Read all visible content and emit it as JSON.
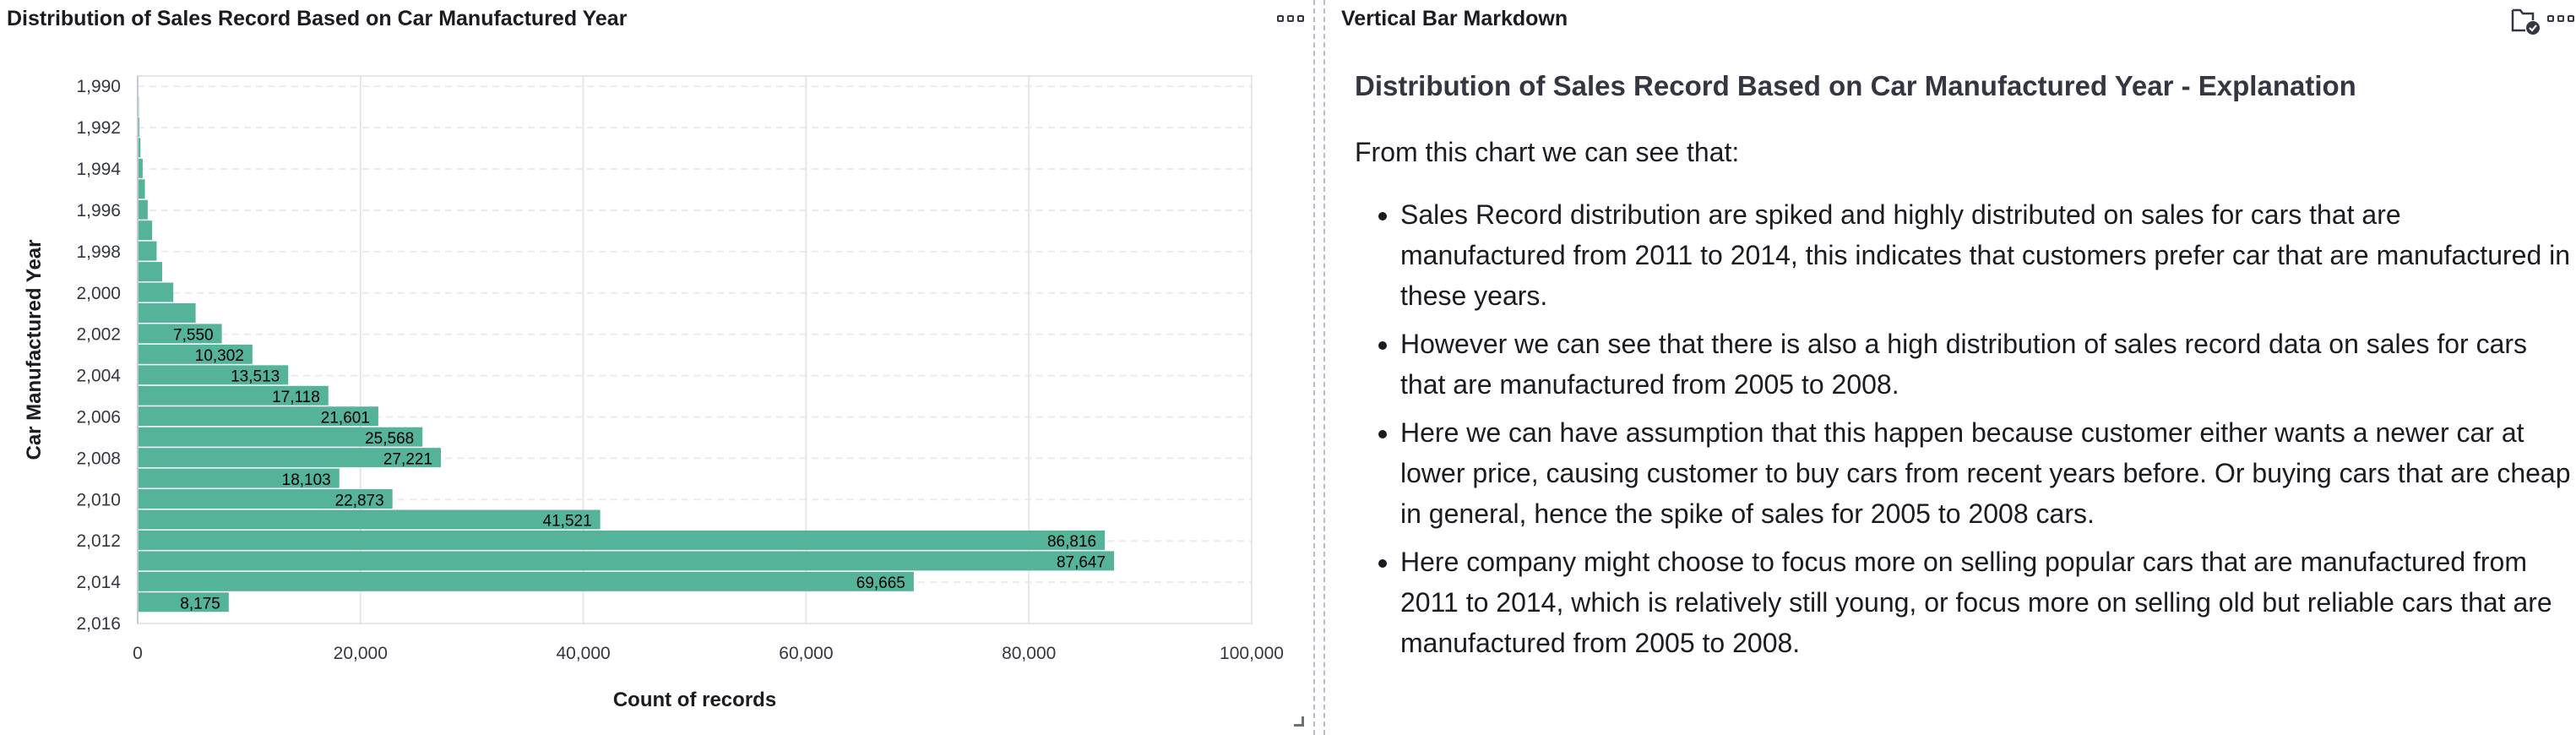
{
  "left_panel": {
    "title": "Distribution of Sales Record Based on Car Manufactured Year"
  },
  "right_panel": {
    "title": "Vertical Bar Markdown",
    "heading": "Distribution of Sales Record Based on Car Manufactured Year - Explanation",
    "intro": "From this chart we can see that:",
    "bullets": [
      "Sales Record distribution are spiked and highly distributed on sales for cars that are manufactured from 2011 to 2014, this indicates that customers prefer car that are manufactured in these years.",
      "However we can see that there is also a high distribution of sales record data on sales for cars that are manufactured from 2005 to 2008.",
      "Here we can have assumption that this happen because customer either wants a newer car at lower price, causing customer to buy cars from recent years before. Or buying cars that are cheap in general, hence the spike of sales for 2005 to 2008 cars.",
      "Here company might choose to focus more on selling popular cars that are manufactured from 2011 to 2014, which is relatively still young, or focus more on selling old but reliable cars that are manufactured from 2005 to 2008."
    ]
  },
  "colors": {
    "bar": "#54b399",
    "text": "#1a1c21",
    "grid": "#e3e6eb"
  },
  "icons": {
    "left_menu": "panel-options-icon",
    "right_menu": "panel-options-icon",
    "right_file": "folder-check-icon"
  },
  "chart_data": {
    "type": "bar",
    "orientation": "horizontal",
    "title": "Distribution of Sales Record Based on Car Manufactured Year",
    "xlabel": "Count of records",
    "ylabel": "Car Manufactured Year",
    "xlim": [
      0,
      100000
    ],
    "ylim": [
      1990,
      2016
    ],
    "x_ticks": [
      "0",
      "20,000",
      "40,000",
      "60,000",
      "80,000",
      "100,000"
    ],
    "y_ticks": [
      "1,990",
      "1,992",
      "1,994",
      "1,996",
      "1,998",
      "2,000",
      "2,002",
      "2,004",
      "2,006",
      "2,008",
      "2,010",
      "2,012",
      "2,014",
      "2,016"
    ],
    "grid": true,
    "bars": [
      {
        "year": 1990,
        "value": 50,
        "label": ""
      },
      {
        "year": 1991,
        "value": 100,
        "label": ""
      },
      {
        "year": 1992,
        "value": 150,
        "label": ""
      },
      {
        "year": 1993,
        "value": 250,
        "label": ""
      },
      {
        "year": 1994,
        "value": 450,
        "label": ""
      },
      {
        "year": 1995,
        "value": 650,
        "label": ""
      },
      {
        "year": 1996,
        "value": 900,
        "label": ""
      },
      {
        "year": 1997,
        "value": 1300,
        "label": ""
      },
      {
        "year": 1998,
        "value": 1700,
        "label": ""
      },
      {
        "year": 1999,
        "value": 2200,
        "label": ""
      },
      {
        "year": 2000,
        "value": 3200,
        "label": ""
      },
      {
        "year": 2001,
        "value": 5200,
        "label": ""
      },
      {
        "year": 2002,
        "value": 7550,
        "label": "7,550"
      },
      {
        "year": 2003,
        "value": 10302,
        "label": "10,302"
      },
      {
        "year": 2004,
        "value": 13513,
        "label": "13,513"
      },
      {
        "year": 2005,
        "value": 17118,
        "label": "17,118"
      },
      {
        "year": 2006,
        "value": 21601,
        "label": "21,601"
      },
      {
        "year": 2007,
        "value": 25568,
        "label": "25,568"
      },
      {
        "year": 2008,
        "value": 27221,
        "label": "27,221"
      },
      {
        "year": 2009,
        "value": 18103,
        "label": "18,103"
      },
      {
        "year": 2010,
        "value": 22873,
        "label": "22,873"
      },
      {
        "year": 2011,
        "value": 41521,
        "label": "41,521"
      },
      {
        "year": 2012,
        "value": 86816,
        "label": "86,816"
      },
      {
        "year": 2013,
        "value": 87647,
        "label": "87,647"
      },
      {
        "year": 2014,
        "value": 69665,
        "label": "69,665"
      },
      {
        "year": 2015,
        "value": 8175,
        "label": "8,175"
      }
    ]
  }
}
